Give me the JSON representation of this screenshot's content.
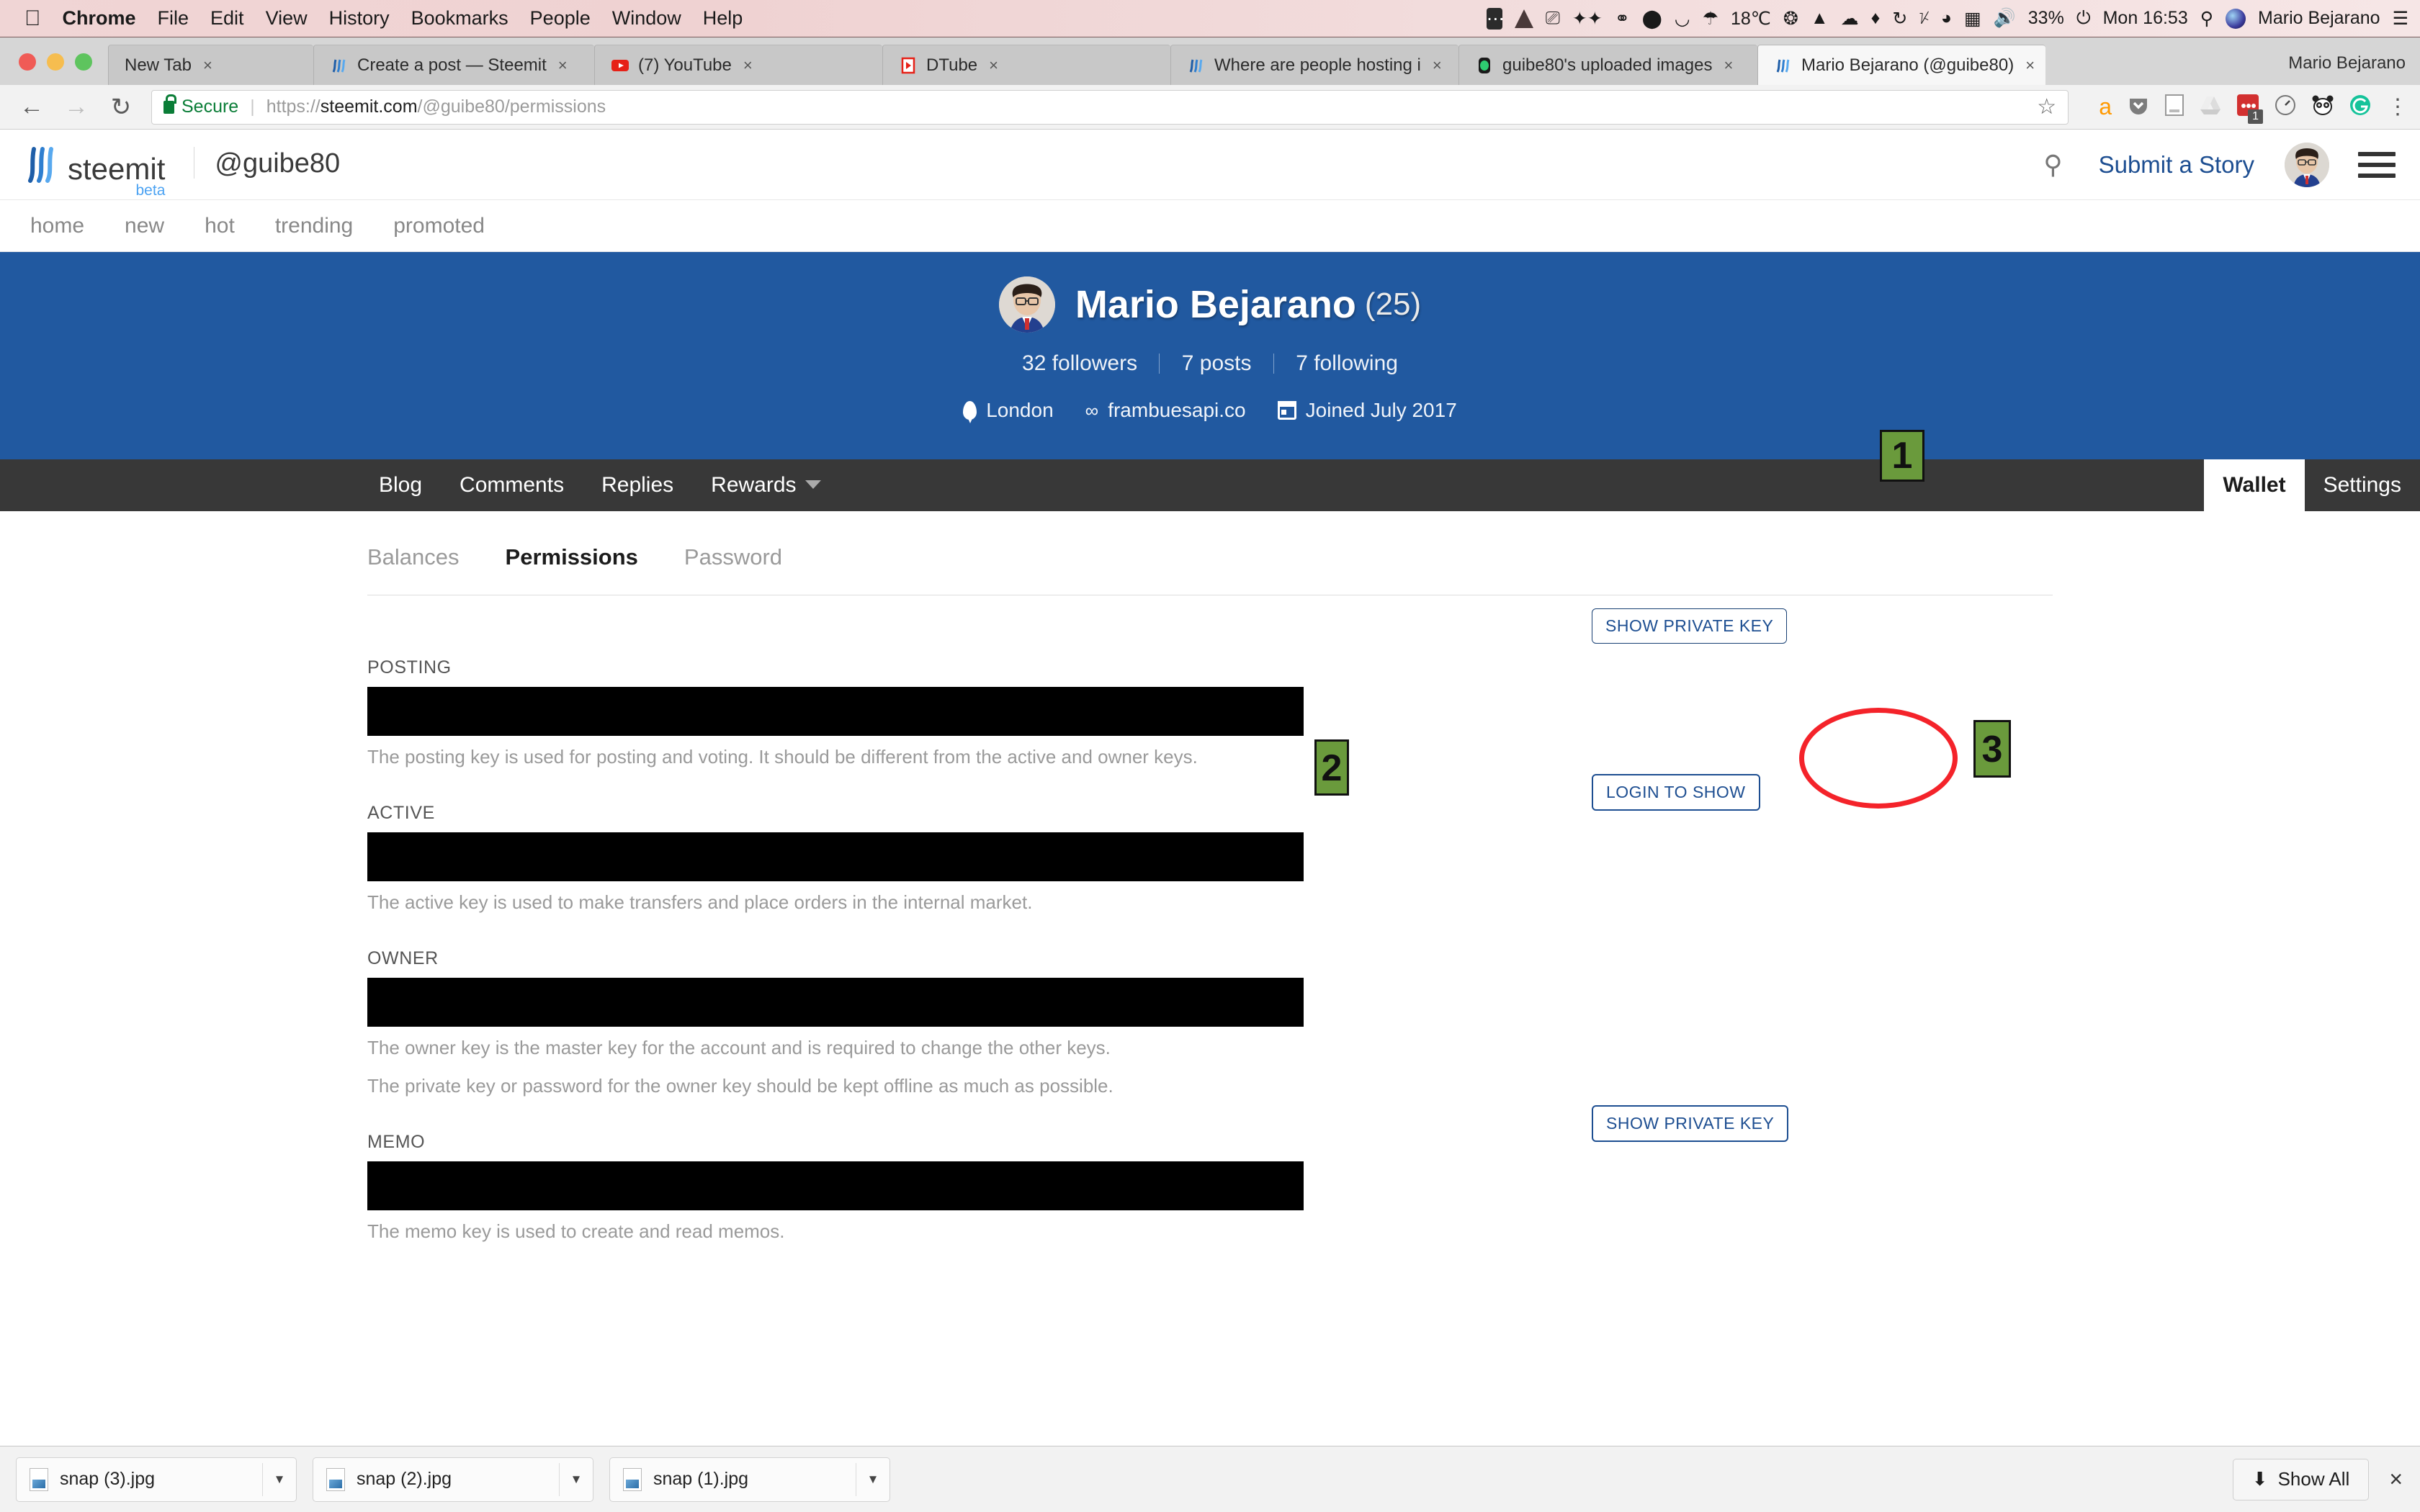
{
  "macbar": {
    "apple": "",
    "menus": [
      "Chrome",
      "File",
      "Edit",
      "View",
      "History",
      "Bookmarks",
      "People",
      "Window",
      "Help"
    ],
    "status": {
      "temperature": "18℃",
      "battery": "33%",
      "clock": "Mon 16:53",
      "user": "Mario Bejarano"
    }
  },
  "chrome": {
    "tabs": [
      {
        "label": "New Tab",
        "favicon": "none",
        "active": false
      },
      {
        "label": "Create a post — Steemit",
        "favicon": "steemit",
        "active": false
      },
      {
        "label": "(7) YouTube",
        "favicon": "youtube",
        "active": false
      },
      {
        "label": "DTube",
        "favicon": "dtube",
        "active": false
      },
      {
        "label": "Where are people hosting i",
        "favicon": "steemit",
        "active": false
      },
      {
        "label": "guibe80's uploaded images",
        "favicon": "green",
        "active": false
      },
      {
        "label": "Mario Bejarano (@guibe80)",
        "favicon": "steemit",
        "active": true
      }
    ],
    "window_title": "Mario Bejarano",
    "url": {
      "secure_label": "Secure",
      "scheme": "https://",
      "host": "steemit.com",
      "path": "/@guibe80/permissions"
    },
    "extension_badge": "1"
  },
  "steemit": {
    "logo_word": "steemit",
    "logo_beta": "beta",
    "logo_user": "@guibe80",
    "submit_label": "Submit a Story",
    "subnav": [
      "home",
      "new",
      "hot",
      "trending",
      "promoted"
    ],
    "profile": {
      "name": "Mario Bejarano",
      "reputation": "(25)",
      "followers": "32 followers",
      "posts": "7 posts",
      "following": "7 following",
      "location": "London",
      "website": "frambuesapi.co",
      "joined": "Joined July 2017"
    },
    "darknav": {
      "left": [
        "Blog",
        "Comments",
        "Replies",
        "Rewards"
      ],
      "right": [
        "Wallet",
        "Settings"
      ],
      "active_right": "Wallet"
    },
    "wallet_tabs": [
      "Balances",
      "Permissions",
      "Password"
    ],
    "wallet_active_tab": "Permissions",
    "permissions": [
      {
        "label": "POSTING",
        "value": "",
        "descriptions": [
          "The posting key is used for posting and voting. It should be different from the active and owner keys."
        ],
        "action": "SHOW PRIVATE KEY"
      },
      {
        "label": "ACTIVE",
        "value": "",
        "descriptions": [
          "The active key is used to make transfers and place orders in the internal market."
        ],
        "action": "LOGIN TO SHOW"
      },
      {
        "label": "OWNER",
        "value": "",
        "descriptions": [
          "The owner key is the master key for the account and is required to change the other keys.",
          "The private key or password for the owner key should be kept offline as much as possible."
        ],
        "action": ""
      },
      {
        "label": "MEMO",
        "value": "",
        "descriptions": [
          "The memo key is used to create and read memos."
        ],
        "action": "SHOW PRIVATE KEY"
      }
    ]
  },
  "annotations": [
    {
      "number": "1",
      "target": "wallet-tab"
    },
    {
      "number": "2",
      "target": "posting-key-field"
    },
    {
      "number": "3",
      "target": "show-private-key-button"
    }
  ],
  "downloads": {
    "files": [
      "snap (3).jpg",
      "snap (2).jpg",
      "snap (1).jpg"
    ],
    "show_all": "Show All",
    "close": "×"
  },
  "colors": {
    "steem_blue": "#2159a0",
    "link_blue": "#1d4e91",
    "annotation_green": "#6a9a3c",
    "highlight_red": "#f4232a",
    "secure_green": "#0a7d37"
  }
}
